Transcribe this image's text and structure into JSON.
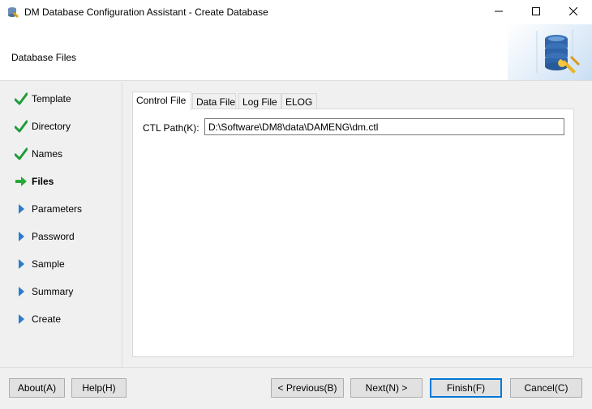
{
  "window": {
    "title": "DM Database Configuration Assistant - Create Database",
    "minimize_icon": "minimize-icon",
    "maximize_icon": "maximize-icon",
    "close_icon": "close-icon"
  },
  "header": {
    "title": "Database Files",
    "art_icon": "database-config-icon"
  },
  "nav": {
    "items": [
      {
        "label": "Template",
        "state": "done",
        "icon": "check-icon"
      },
      {
        "label": "Directory",
        "state": "done",
        "icon": "check-icon"
      },
      {
        "label": "Names",
        "state": "done",
        "icon": "check-icon"
      },
      {
        "label": "Files",
        "state": "current",
        "icon": "arrow-right-icon"
      },
      {
        "label": "Parameters",
        "state": "pending",
        "icon": "triangle-right-icon"
      },
      {
        "label": "Password",
        "state": "pending",
        "icon": "triangle-right-icon"
      },
      {
        "label": "Sample",
        "state": "pending",
        "icon": "triangle-right-icon"
      },
      {
        "label": "Summary",
        "state": "pending",
        "icon": "triangle-right-icon"
      },
      {
        "label": "Create",
        "state": "pending",
        "icon": "triangle-right-icon"
      }
    ]
  },
  "tabs": [
    {
      "label": "Control File",
      "active": true
    },
    {
      "label": "Data File",
      "active": false
    },
    {
      "label": "Log File",
      "active": false
    },
    {
      "label": "ELOG",
      "active": false
    }
  ],
  "control_file": {
    "ctl_path_label": "CTL Path(K):",
    "ctl_path_value": "D:\\Software\\DM8\\data\\DAMENG\\dm.ctl"
  },
  "buttons": {
    "about": "About(A)",
    "help": "Help(H)",
    "previous": "< Previous(B)",
    "next": "Next(N) >",
    "finish": "Finish(F)",
    "cancel": "Cancel(C)"
  },
  "colors": {
    "check": "#1f9c3a",
    "current_arrow": "#2aa838",
    "pending_triangle": "#2b7bd0",
    "default_button_border": "#0078d7"
  }
}
